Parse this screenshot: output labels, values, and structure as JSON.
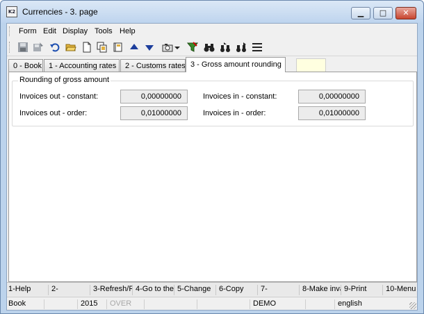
{
  "window": {
    "title": "Currencies - 3. page",
    "app_icon_text": "K2",
    "minimize_glyph": "▁",
    "maximize_glyph": "□",
    "close_glyph": "✕"
  },
  "menu": {
    "items": [
      "Form",
      "Edit",
      "Display",
      "Tools",
      "Help"
    ]
  },
  "toolbar": {
    "icons": [
      "save-icon",
      "save-as-icon",
      "undo-icon",
      "open-folder-icon",
      "new-document-icon",
      "copy-icon",
      "book-icon",
      "arrow-up-icon",
      "arrow-down-icon",
      "camera-icon",
      "dropdown-arrow-icon",
      "filter-icon",
      "binoculars-icon",
      "binoculars-next-icon",
      "binoculars-all-icon",
      "list-icon"
    ]
  },
  "tabs": {
    "items": [
      {
        "label": "0 - Book"
      },
      {
        "label": "1 - Accounting rates"
      },
      {
        "label": "2 - Customs rates"
      },
      {
        "label": "3 - Gross amount rounding"
      }
    ],
    "active_index": 3
  },
  "rounding": {
    "group_title": "Rounding of gross amount",
    "invoices_out_constant_label": "Invoices out - constant:",
    "invoices_out_constant_value": "0,00000000",
    "invoices_out_order_label": "Invoices out - order:",
    "invoices_out_order_value": "0,01000000",
    "invoices_in_constant_label": "Invoices in - constant:",
    "invoices_in_constant_value": "0,00000000",
    "invoices_in_order_label": "Invoices in - order:",
    "invoices_in_order_value": "0,01000000"
  },
  "fkeys": [
    "1-Help",
    "2-",
    "3-Refresh/F",
    "4-Go to the",
    "5-Change",
    "6-Copy",
    "7-",
    "8-Make inva",
    "9-Print",
    "10-Menu"
  ],
  "status": {
    "module": "Book",
    "cell2": "",
    "year": "2015",
    "mode": "OVER",
    "cell5": "",
    "cell6": "",
    "db": "DEMO",
    "cell8": "",
    "language": "english"
  },
  "colors": {
    "title_bar": "#bed4ee",
    "close_button": "#c8452f",
    "readonly_field": "#ececec",
    "blank_tab": "#ffffe0"
  }
}
